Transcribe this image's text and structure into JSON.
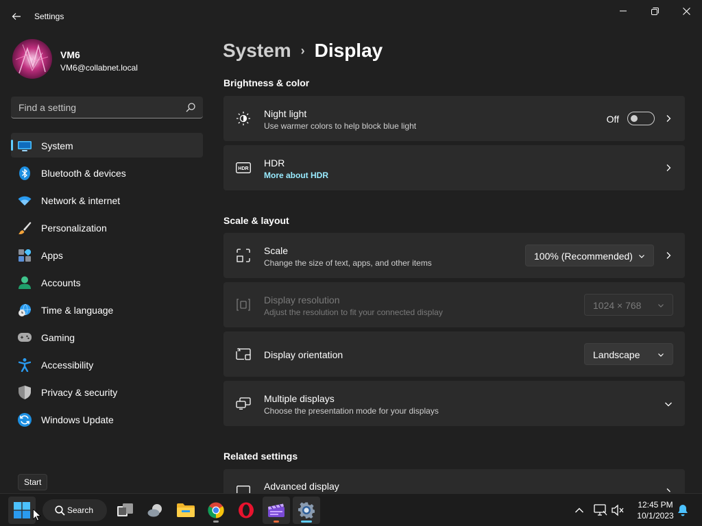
{
  "window": {
    "title": "Settings",
    "back_icon": "back-arrow-icon",
    "controls": [
      "minimize-icon",
      "restore-icon",
      "close-icon"
    ]
  },
  "profile": {
    "name": "VM6",
    "email": "VM6@collabnet.local"
  },
  "search": {
    "placeholder": "Find a setting",
    "value": ""
  },
  "sidebar": {
    "items": [
      {
        "label": "System",
        "icon": "system-monitor-icon",
        "active": true
      },
      {
        "label": "Bluetooth & devices",
        "icon": "bluetooth-icon"
      },
      {
        "label": "Network & internet",
        "icon": "wifi-icon"
      },
      {
        "label": "Personalization",
        "icon": "paintbrush-icon"
      },
      {
        "label": "Apps",
        "icon": "apps-icon"
      },
      {
        "label": "Accounts",
        "icon": "account-icon"
      },
      {
        "label": "Time & language",
        "icon": "globe-clock-icon"
      },
      {
        "label": "Gaming",
        "icon": "gamepad-icon"
      },
      {
        "label": "Accessibility",
        "icon": "accessibility-icon"
      },
      {
        "label": "Privacy & security",
        "icon": "shield-icon"
      },
      {
        "label": "Windows Update",
        "icon": "update-icon"
      }
    ]
  },
  "tooltip": {
    "text": "Start"
  },
  "breadcrumb": {
    "parent": "System",
    "separator": "›",
    "current": "Display"
  },
  "sections": {
    "brightness": "Brightness & color",
    "scale": "Scale & layout",
    "related": "Related settings"
  },
  "night_light": {
    "title": "Night light",
    "subtitle": "Use warmer colors to help block blue light",
    "state_label": "Off",
    "enabled": false
  },
  "hdr": {
    "title": "HDR",
    "link": "More about HDR"
  },
  "scale": {
    "title": "Scale",
    "subtitle": "Change the size of text, apps, and other items",
    "value": "100% (Recommended)"
  },
  "resolution": {
    "title": "Display resolution",
    "subtitle": "Adjust the resolution to fit your connected display",
    "value": "1024 × 768",
    "disabled": true
  },
  "orientation": {
    "title": "Display orientation",
    "value": "Landscape"
  },
  "multiple_displays": {
    "title": "Multiple displays",
    "subtitle": "Choose the presentation mode for your displays"
  },
  "advanced_display": {
    "title": "Advanced display"
  },
  "taskbar": {
    "search_label": "Search",
    "apps": [
      "start-icon",
      "task-view-icon",
      "weather-widget-icon",
      "file-explorer-icon",
      "chrome-icon",
      "opera-icon",
      "clipchamp-icon",
      "settings-gear-icon"
    ],
    "time": "12:45 PM",
    "date": "10/1/2023"
  },
  "colors": {
    "accent": "#60cdff",
    "background": "#202020",
    "card": "#2b2b2b",
    "link": "#99ebff"
  }
}
